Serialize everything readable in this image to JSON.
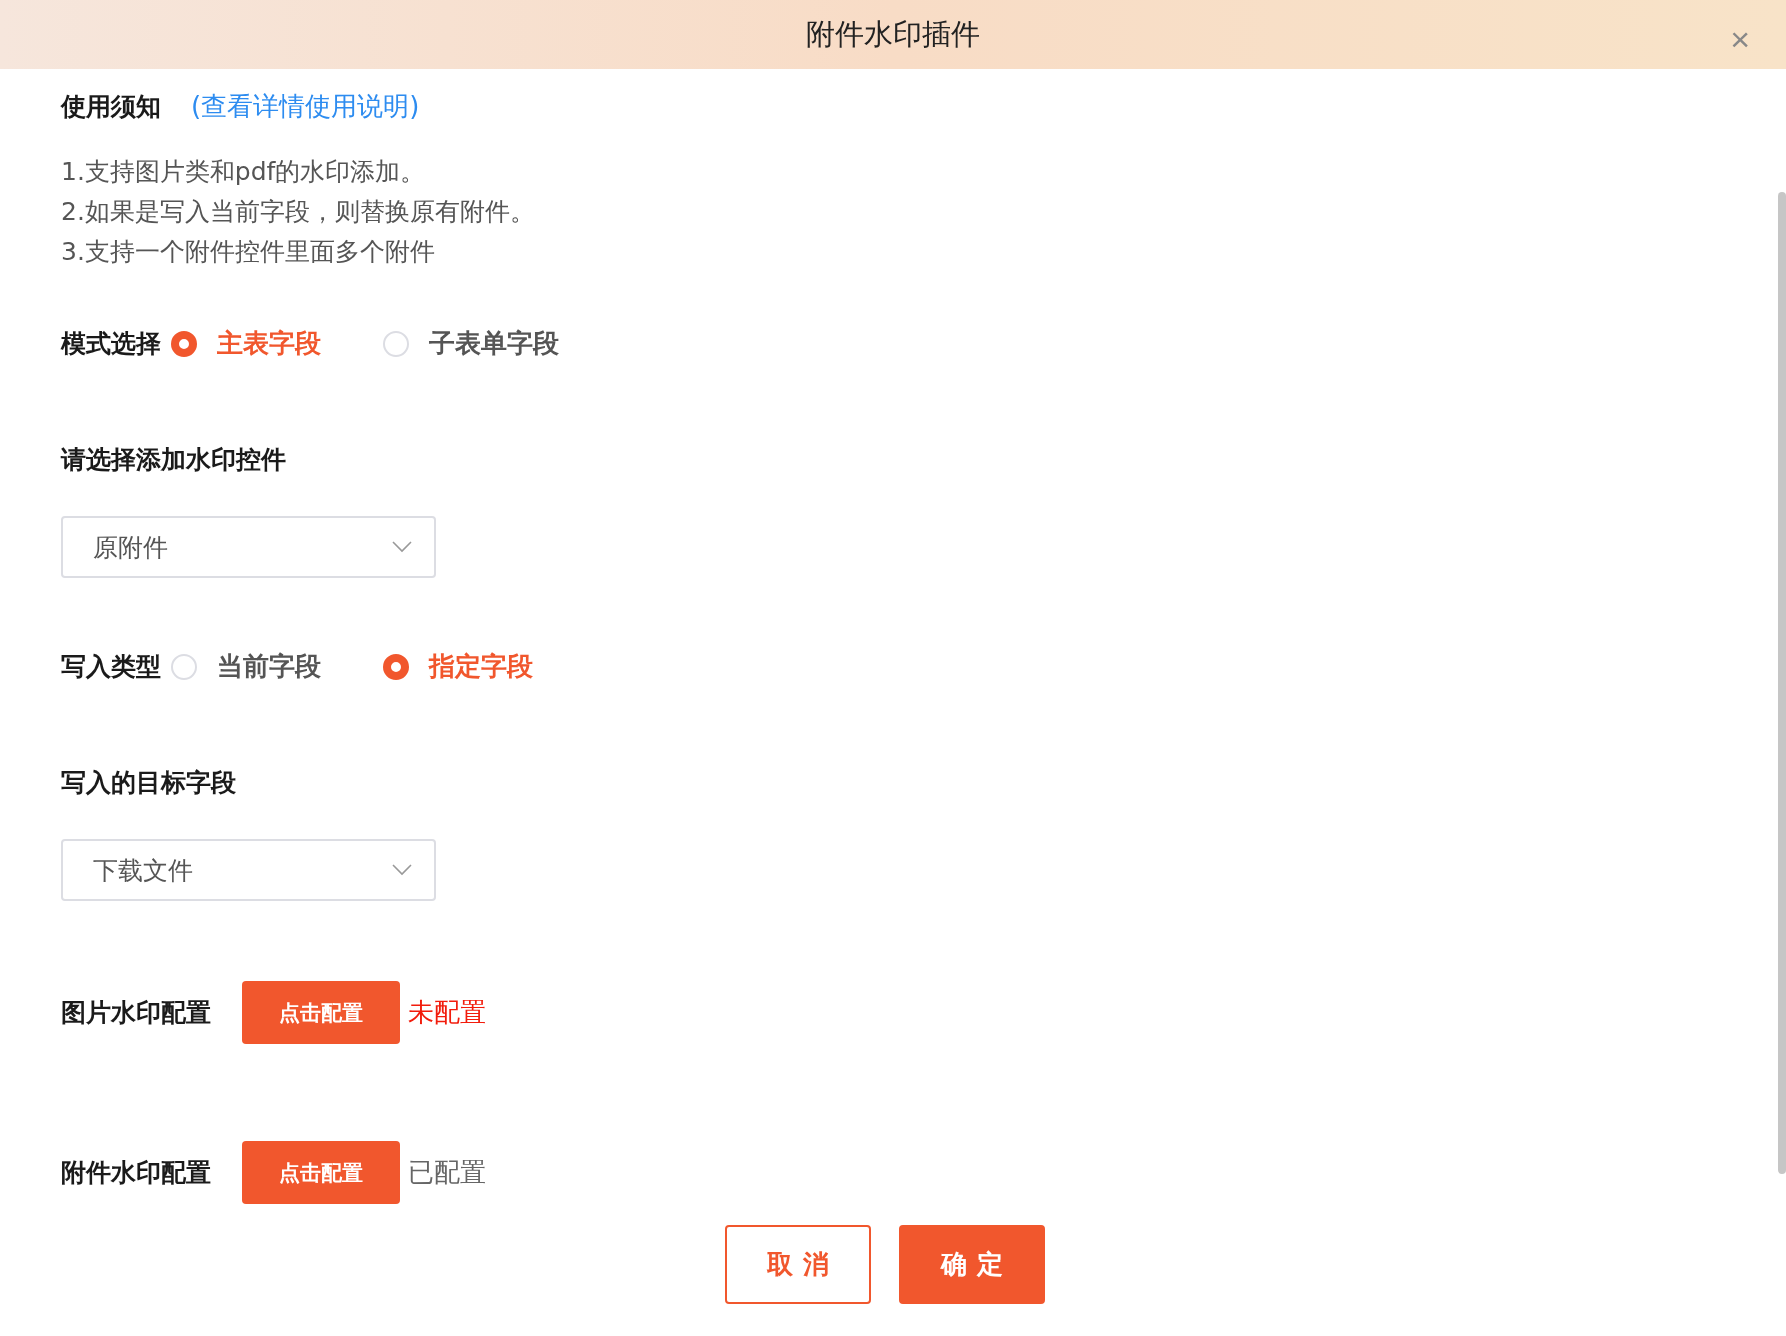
{
  "dialog": {
    "title": "附件水印插件",
    "close": "×"
  },
  "notice": {
    "title": "使用须知",
    "link": "(查看详情使用说明)",
    "lines": [
      "1.支持图片类和pdf的水印添加。",
      "2.如果是写入当前字段，则替换原有附件。",
      "3.支持一个附件控件里面多个附件"
    ]
  },
  "mode": {
    "label": "模式选择",
    "options": [
      {
        "label": "主表字段",
        "selected": true
      },
      {
        "label": "子表单字段",
        "selected": false
      }
    ]
  },
  "source_select": {
    "label": "请选择添加水印控件",
    "value": "原附件"
  },
  "write_type": {
    "label": "写入类型",
    "options": [
      {
        "label": "当前字段",
        "selected": false
      },
      {
        "label": "指定字段",
        "selected": true
      }
    ]
  },
  "target_select": {
    "label": "写入的目标字段",
    "value": "下载文件"
  },
  "configs": [
    {
      "label": "图片水印配置",
      "button": "点击配置",
      "status": "未配置",
      "configured": false
    },
    {
      "label": "附件水印配置",
      "button": "点击配置",
      "status": "已配置",
      "configured": true
    }
  ],
  "footer": {
    "cancel": "取 消",
    "confirm": "确 定"
  }
}
